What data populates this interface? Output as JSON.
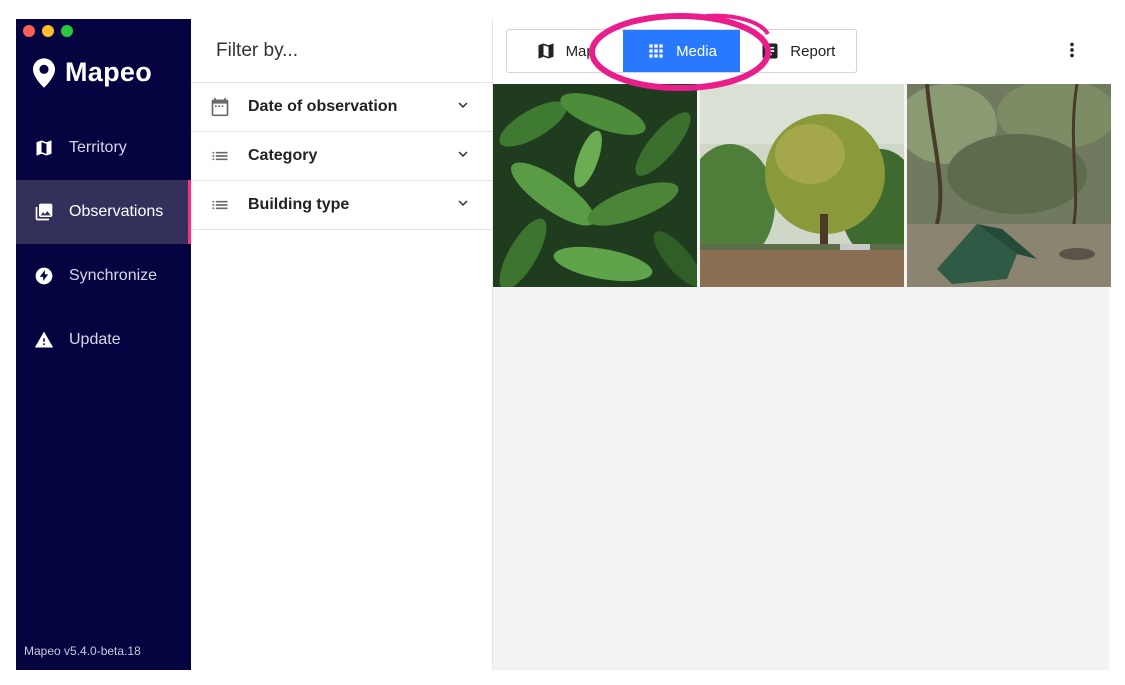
{
  "app": {
    "name": "Mapeo",
    "version": "Mapeo v5.4.0-beta.18"
  },
  "sidebar": {
    "items": [
      {
        "label": "Territory",
        "icon": "map-icon",
        "active": false
      },
      {
        "label": "Observations",
        "icon": "photo-library-icon",
        "active": true
      },
      {
        "label": "Synchronize",
        "icon": "flash-icon",
        "active": false
      },
      {
        "label": "Update",
        "icon": "warning-icon",
        "active": false
      }
    ]
  },
  "filters": {
    "title": "Filter by...",
    "items": [
      {
        "label": "Date of observation",
        "icon": "calendar-icon"
      },
      {
        "label": "Category",
        "icon": "list-icon"
      },
      {
        "label": "Building type",
        "icon": "list-icon"
      }
    ]
  },
  "toolbar": {
    "tabs": [
      {
        "label": "Map",
        "icon": "map-icon",
        "selected": false
      },
      {
        "label": "Media",
        "icon": "grid-icon",
        "selected": true
      },
      {
        "label": "Report",
        "icon": "report-icon",
        "selected": false
      }
    ],
    "more_icon": "more-vertical-icon"
  },
  "media": {
    "thumbnails": [
      {
        "subject": "dense green leaves"
      },
      {
        "subject": "tree by river bank"
      },
      {
        "subject": "tent under canopy"
      }
    ]
  },
  "colors": {
    "sidebar_bg": "#050441",
    "active_tab": "#2979ff",
    "active_indicator": "#ff2d7a",
    "annotation_ring": "#e91e8c"
  }
}
